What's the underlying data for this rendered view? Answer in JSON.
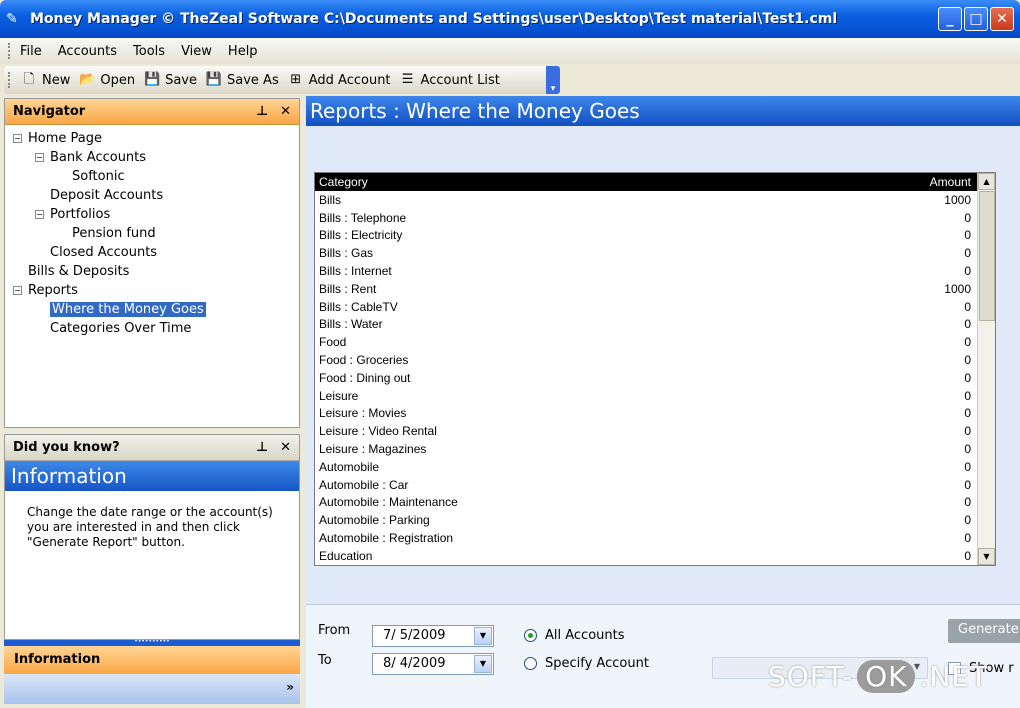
{
  "window": {
    "title": "Money Manager © TheZeal Software C:\\Documents and Settings\\user\\Desktop\\Test material\\Test1.cml"
  },
  "menu": [
    "File",
    "Accounts",
    "Tools",
    "View",
    "Help"
  ],
  "toolbar": {
    "new": "New",
    "open": "Open",
    "save": "Save",
    "save_as": "Save As",
    "add_account": "Add Account",
    "account_list": "Account List"
  },
  "navigator": {
    "title": "Navigator",
    "tree": [
      {
        "label": "Home Page",
        "level": 0,
        "toggle": "-"
      },
      {
        "label": "Bank Accounts",
        "level": 1,
        "toggle": "-"
      },
      {
        "label": "Softonic",
        "level": 2,
        "toggle": ""
      },
      {
        "label": "Deposit Accounts",
        "level": 1,
        "toggle": ""
      },
      {
        "label": "Portfolios",
        "level": 1,
        "toggle": "-"
      },
      {
        "label": "Pension fund",
        "level": 2,
        "toggle": ""
      },
      {
        "label": "Closed Accounts",
        "level": 1,
        "toggle": ""
      },
      {
        "label": "Bills & Deposits",
        "level": 0,
        "toggle": ""
      },
      {
        "label": "Reports",
        "level": 0,
        "toggle": "-"
      },
      {
        "label": "Where the Money Goes",
        "level": 1,
        "toggle": "",
        "selected": true
      },
      {
        "label": "Categories Over Time",
        "level": 1,
        "toggle": ""
      }
    ]
  },
  "did_you_know": {
    "title": "Did you know?",
    "header": "Information",
    "text": "Change the date range or the account(s) you are interested in and then click \"Generate Report\" button.",
    "tab_label": "Information"
  },
  "report": {
    "title": "Reports : Where the Money Goes",
    "columns": {
      "category": "Category",
      "amount": "Amount"
    },
    "rows": [
      [
        "Bills",
        "1000"
      ],
      [
        "Bills : Telephone",
        "0"
      ],
      [
        "Bills : Electricity",
        "0"
      ],
      [
        "Bills : Gas",
        "0"
      ],
      [
        "Bills : Internet",
        "0"
      ],
      [
        "Bills : Rent",
        "1000"
      ],
      [
        "Bills : CableTV",
        "0"
      ],
      [
        "Bills : Water",
        "0"
      ],
      [
        "Food",
        "0"
      ],
      [
        "Food : Groceries",
        "0"
      ],
      [
        "Food : Dining out",
        "0"
      ],
      [
        "Leisure",
        "0"
      ],
      [
        "Leisure : Movies",
        "0"
      ],
      [
        "Leisure : Video Rental",
        "0"
      ],
      [
        "Leisure : Magazines",
        "0"
      ],
      [
        "Automobile",
        "0"
      ],
      [
        "Automobile : Car",
        "0"
      ],
      [
        "Automobile : Maintenance",
        "0"
      ],
      [
        "Automobile : Parking",
        "0"
      ],
      [
        "Automobile : Registration",
        "0"
      ],
      [
        "Education",
        "0"
      ]
    ]
  },
  "controls": {
    "from_label": "From",
    "to_label": "To",
    "from_value": "7/ 5/2009",
    "to_value": "8/ 4/2009",
    "all_accounts": "All Accounts",
    "specify_account": "Specify Account",
    "generate": "Generate Report",
    "show": "Show r"
  },
  "watermark": {
    "left": "SOFT-",
    "ok": "OK",
    "right": ".NET"
  }
}
